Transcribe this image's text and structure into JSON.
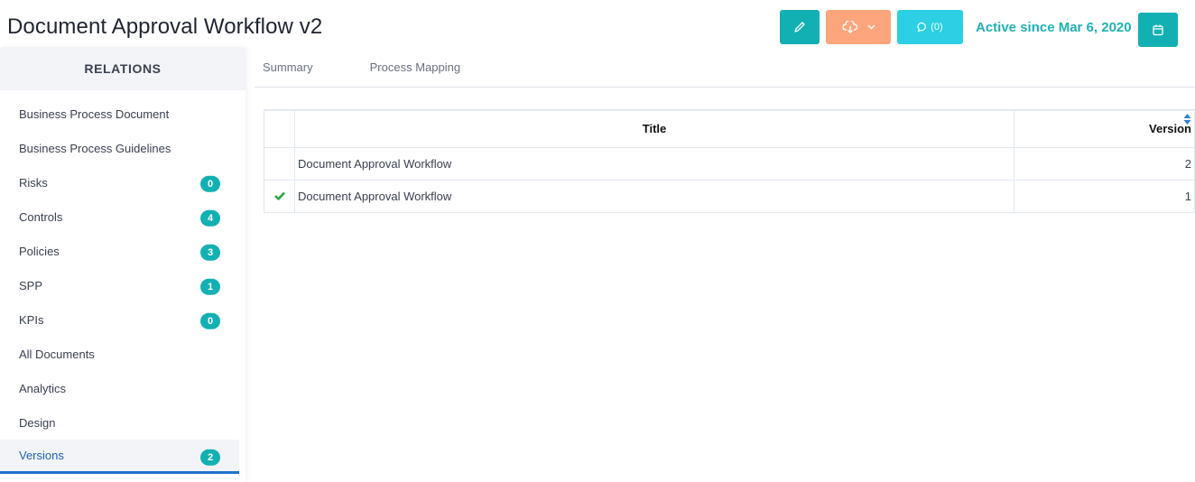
{
  "header": {
    "title": "Document Approval Workflow v2",
    "active_since": "Active since Mar 6, 2020",
    "comments_label": "(0)",
    "icons": {
      "edit": "pencil-icon",
      "download": "cloud-download-icon",
      "dropdown": "chevron-down-icon",
      "comments": "comment-icon",
      "calendar": "calendar-icon"
    },
    "colors": {
      "primary": "#13b0b3",
      "download": "#fda57d",
      "comments": "#2ccfe3",
      "active_text": "#1fb1b5"
    }
  },
  "sidebar": {
    "header": "RELATIONS",
    "items": [
      {
        "label": "Business Process Document"
      },
      {
        "label": "Business Process Guidelines"
      },
      {
        "label": "Risks",
        "badge": "0"
      },
      {
        "label": "Controls",
        "badge": "4"
      },
      {
        "label": "Policies",
        "badge": "3"
      },
      {
        "label": "SPP",
        "badge": "1"
      },
      {
        "label": "KPIs",
        "badge": "0"
      },
      {
        "label": "All Documents"
      },
      {
        "label": "Analytics"
      },
      {
        "label": "Design"
      },
      {
        "label": "Versions",
        "badge": "2",
        "active": true
      }
    ]
  },
  "tabs": [
    {
      "label": "Summary"
    },
    {
      "label": "Process Mapping"
    }
  ],
  "versions_table": {
    "columns": [
      "",
      "Title",
      "Version"
    ],
    "sort_column": "Version",
    "rows": [
      {
        "current": false,
        "title": "Document Approval Workflow",
        "version": "2"
      },
      {
        "current": true,
        "title": "Document Approval Workflow",
        "version": "1"
      }
    ]
  }
}
